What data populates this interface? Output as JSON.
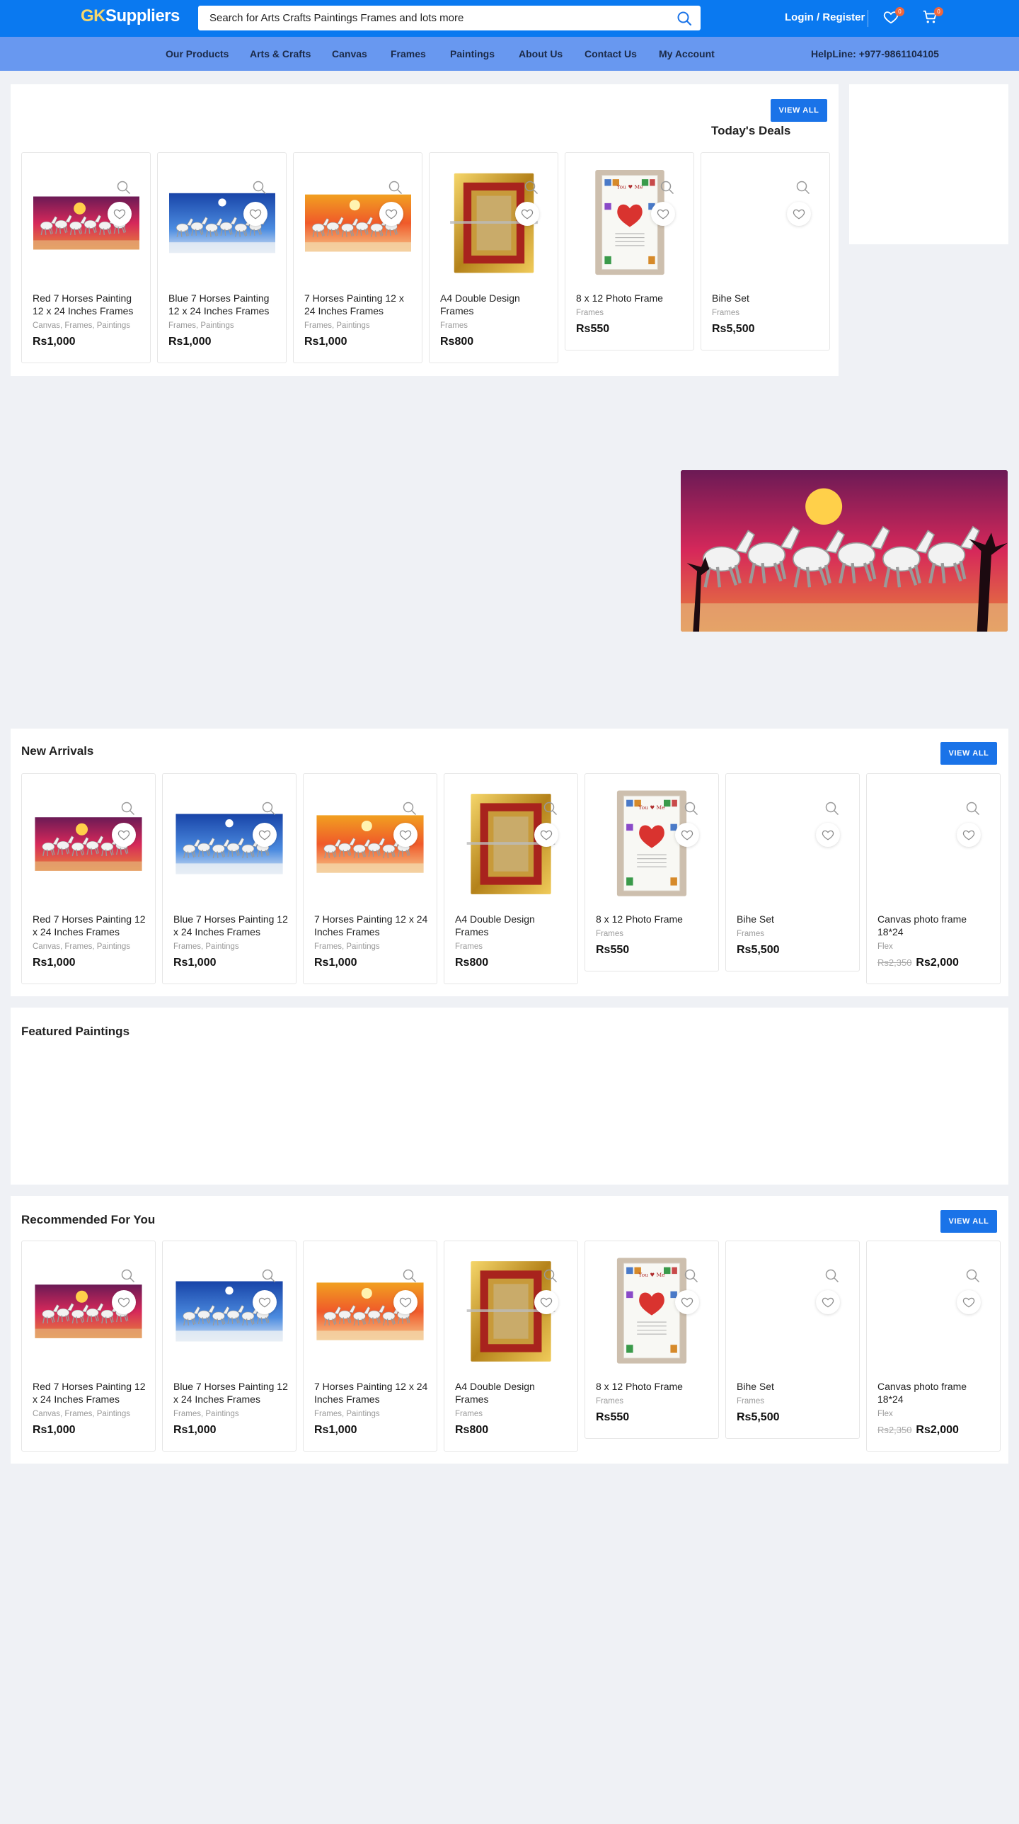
{
  "header": {
    "logo_gk": "GK",
    "logo_rest": "Suppliers",
    "search_placeholder": "Search for Arts Crafts Paintings Frames and lots more",
    "login_label": "Login / Register",
    "wishlist_count": "0",
    "cart_count": "0"
  },
  "nav": {
    "items": [
      "Our Products",
      "Arts & Crafts",
      "Canvas",
      "Frames",
      "Paintings",
      "About Us",
      "Contact Us",
      "My Account"
    ],
    "helpline": "HelpLine: +977-9861104105"
  },
  "icons": {
    "search": "search-icon",
    "wishlist": "heart-icon",
    "cart": "cart-icon",
    "zoom": "zoom-icon"
  },
  "colors": {
    "topbar": "#0a79f0",
    "navbar": "#6898f0",
    "button": "#1a73e8",
    "badge": "#f0663c"
  },
  "todays_deals": {
    "title": "Today's Deals",
    "view_all": "VIEW ALL",
    "products": [
      {
        "name": "Red 7 Horses Painting 12 x 24 Inches Frames",
        "category": "Canvas, Frames, Paintings",
        "price": "Rs1,000"
      },
      {
        "name": "Blue 7 Horses Painting 12 x 24 Inches Frames",
        "category": "Frames, Paintings",
        "price": "Rs1,000"
      },
      {
        "name": "7 Horses Painting 12 x 24 Inches Frames",
        "category": "Frames, Paintings",
        "price": "Rs1,000"
      },
      {
        "name": "A4 Double Design Frames",
        "category": "Frames",
        "price": "Rs800"
      },
      {
        "name": "8 x 12 Photo Frame",
        "category": "Frames",
        "price": "Rs550"
      },
      {
        "name": "Bihe Set",
        "category": "Frames",
        "price": "Rs5,500"
      }
    ]
  },
  "new_arrivals": {
    "title": "New Arrivals",
    "view_all": "VIEW ALL",
    "products": [
      {
        "name": "Red 7 Horses Painting 12 x 24 Inches Frames",
        "category": "Canvas, Frames, Paintings",
        "price": "Rs1,000"
      },
      {
        "name": "Blue 7 Horses Painting 12 x 24 Inches Frames",
        "category": "Frames, Paintings",
        "price": "Rs1,000"
      },
      {
        "name": "7 Horses Painting 12 x 24 Inches Frames",
        "category": "Frames, Paintings",
        "price": "Rs1,000"
      },
      {
        "name": "A4 Double Design Frames",
        "category": "Frames",
        "price": "Rs800"
      },
      {
        "name": "8 x 12 Photo Frame",
        "category": "Frames",
        "price": "Rs550"
      },
      {
        "name": "Bihe Set",
        "category": "Frames",
        "price": "Rs5,500"
      },
      {
        "name": "Canvas photo frame 18*24",
        "category": "Flex",
        "old_price": "Rs2,350",
        "price": "Rs2,000"
      }
    ]
  },
  "featured": {
    "title": "Featured Paintings"
  },
  "recommended": {
    "title": "Recommended For You",
    "view_all": "VIEW ALL",
    "products": [
      {
        "name": "Red 7 Horses Painting 12 x 24 Inches Frames",
        "category": "Canvas, Frames, Paintings",
        "price": "Rs1,000"
      },
      {
        "name": "Blue 7 Horses Painting 12 x 24 Inches Frames",
        "category": "Frames, Paintings",
        "price": "Rs1,000"
      },
      {
        "name": "7 Horses Painting 12 x 24 Inches Frames",
        "category": "Frames, Paintings",
        "price": "Rs1,000"
      },
      {
        "name": "A4 Double Design Frames",
        "category": "Frames",
        "price": "Rs800"
      },
      {
        "name": "8 x 12 Photo Frame",
        "category": "Frames",
        "price": "Rs550"
      },
      {
        "name": "Bihe Set",
        "category": "Frames",
        "price": "Rs5,500"
      },
      {
        "name": "Canvas photo frame 18*24",
        "category": "Flex",
        "old_price": "Rs2,350",
        "price": "Rs2,000"
      }
    ]
  }
}
